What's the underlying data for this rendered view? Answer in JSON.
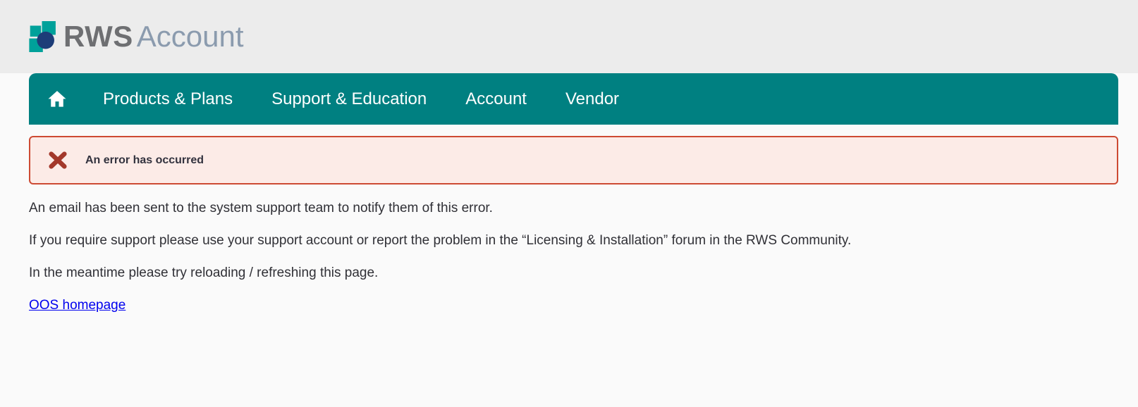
{
  "app": {
    "brand_bold": "RWS",
    "brand_light": "Account"
  },
  "nav": {
    "items": [
      "Products & Plans",
      "Support & Education",
      "Account",
      "Vendor"
    ]
  },
  "alert": {
    "title": "An error has occurred"
  },
  "content": {
    "paragraphs": [
      "An email has been sent to the system support team to notify them of this error.",
      "If you require support please use your support account or report the problem in the “Licensing & Installation” forum in the RWS Community.",
      "In the meantime please try reloading / refreshing this page."
    ],
    "link_label": "OOS homepage"
  },
  "icons": {
    "logo_mark": "rws-logo-icon",
    "home": "home-icon",
    "error": "error-x-icon"
  },
  "colors": {
    "header_bg": "#ececec",
    "page_bg": "#fafafa",
    "nav_teal": "#008081",
    "nav_text": "#ffffff",
    "logo_teal": "#00a19a",
    "logo_navy": "#1d3d78",
    "brand_bold_gray": "#6e6f72",
    "brand_light_slate": "#8b9bae",
    "alert_bg": "#fcebe7",
    "alert_border": "#cd4a33",
    "error_icon_red": "#a3382b",
    "alert_title_text": "#32323e",
    "body_text": "#303036",
    "link_blue": "#0000ee"
  }
}
